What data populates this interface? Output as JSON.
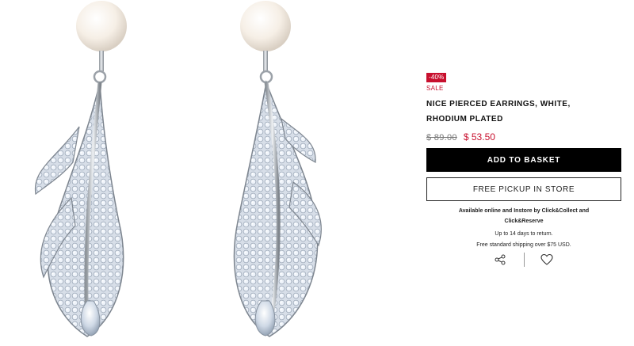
{
  "product": {
    "image_alt": "earrings-product-image",
    "badge": "-40%",
    "sale_label": "SALE",
    "title": "NICE PIERCED EARRINGS, WHITE, RHODIUM PLATED",
    "old_price": "$ 89.00",
    "new_price": "$ 53.50"
  },
  "actions": {
    "add_to_basket": "ADD TO BASKET",
    "free_pickup": "FREE PICKUP IN STORE",
    "share_icon": "share-icon",
    "wishlist_icon": "heart-icon"
  },
  "info": {
    "availability_line1": "Available online and Instore by Click&Collect and",
    "availability_line2": "Click&Reserve",
    "returns": "Up to 14 days to return.",
    "shipping": "Free standard shipping over $75 USD."
  },
  "colors": {
    "sale_red": "#c8102e",
    "button_black": "#000000"
  }
}
